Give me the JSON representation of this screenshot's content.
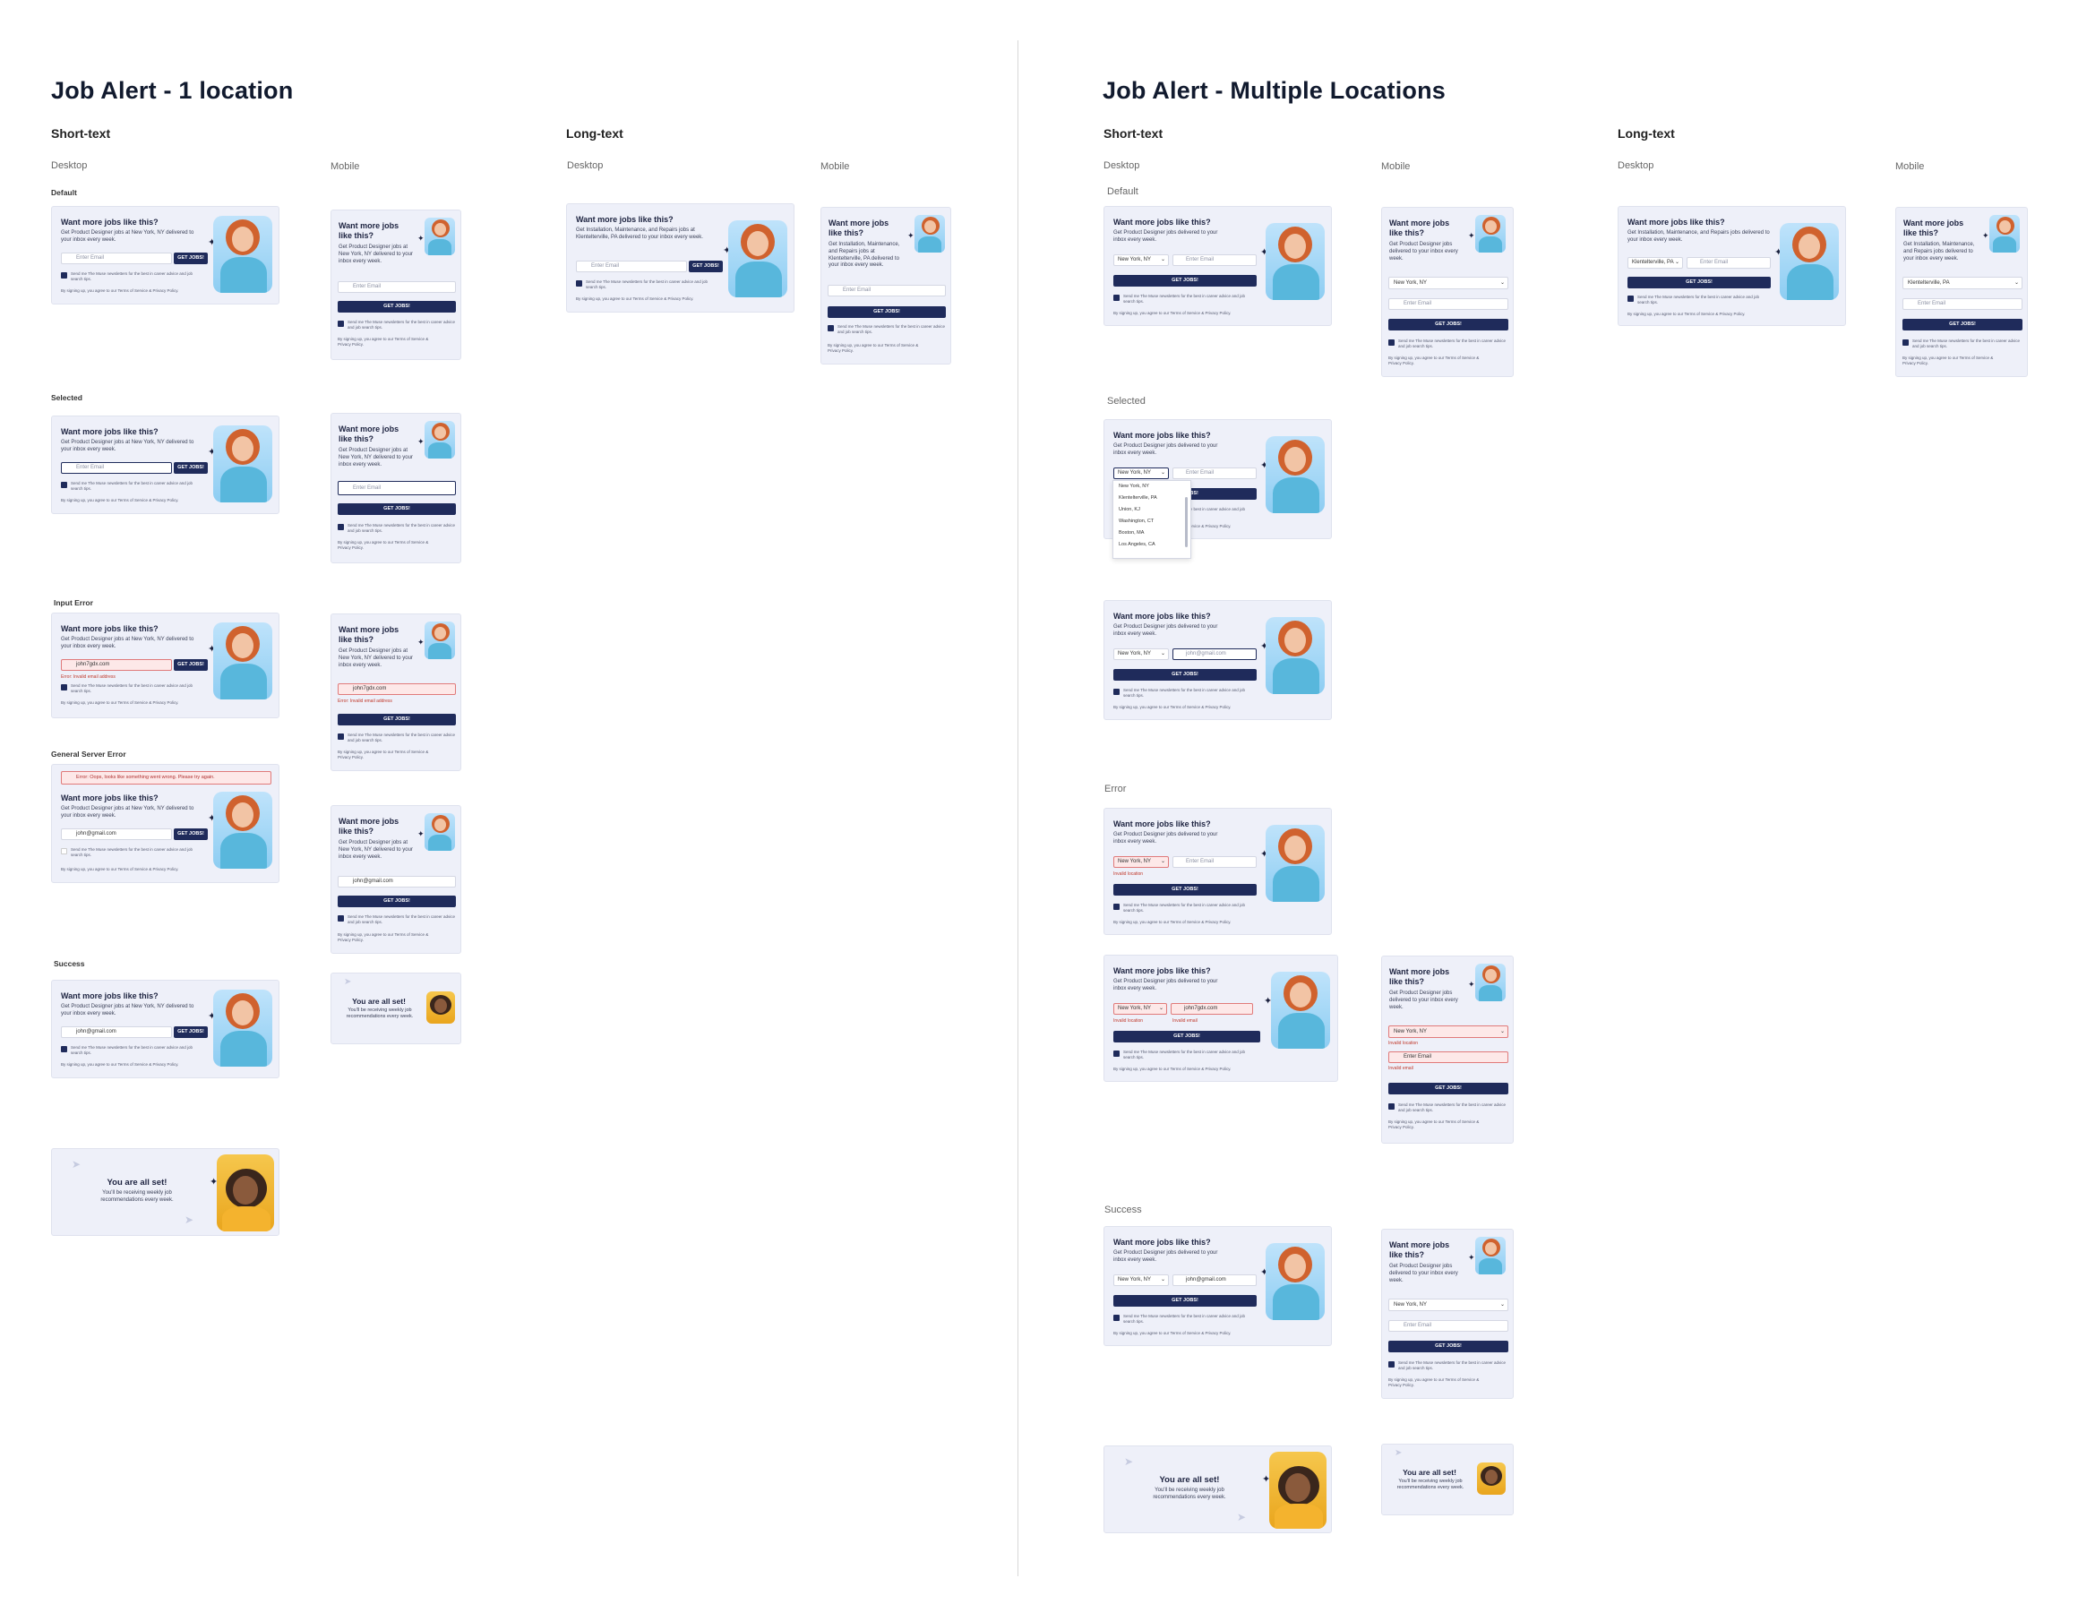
{
  "left": {
    "title": "Job Alert - 1 location",
    "short_text": "Short-text",
    "long_text": "Long-text",
    "desktop": "Desktop",
    "mobile": "Mobile",
    "desktop2": "Desktop",
    "mobile2": "Mobile",
    "states": {
      "default": "Default",
      "selected": "Selected",
      "input_error": "Input Error",
      "server_error": "General Server Error",
      "success": "Success"
    }
  },
  "right": {
    "title": "Job Alert - Multiple Locations",
    "short_text": "Short-text",
    "long_text": "Long-text",
    "desktop": "Desktop",
    "mobile": "Mobile",
    "desktop2": "Desktop",
    "mobile2": "Mobile",
    "states": {
      "default": "Default",
      "selected": "Selected",
      "error": "Error",
      "success": "Success"
    }
  },
  "card": {
    "title": "Want more jobs like this?",
    "desc_short": "Get Product Designer jobs at New York, NY delivered to your inbox every week.",
    "desc_multi": "Get Product Designer jobs delivered to your inbox every week.",
    "desc_long": "Get Installation, Maintenance, and Repairs jobs at Klentelterville, PA delivered to your inbox every week.",
    "desc_long_multi": "Get Installation, Maintenance, and Repairs jobs delivered to your inbox every week.",
    "email_placeholder": "Enter Email",
    "email_value_err": "john7gdx.com",
    "email_value_ok": "john@gmail.com",
    "location_value": "New York, NY",
    "location_long": "Klentelterville, PA",
    "button": "GET JOBS!",
    "checkbox_text": "Send me The Muse newsletters for the best in career advice and job search tips.",
    "fine_print": "By signing up, you agree to our Terms of Service & Privacy Policy.",
    "error_email": "Error: Invalid email address",
    "error_location": "Invalid location",
    "error_email_short": "Invalid email",
    "server_error": "Error: Oops, looks like something went wrong. Please try again.",
    "success_title": "You are all set!",
    "success_desc": "You'll be receiving weekly job recommendations every week.",
    "dropdown_options": [
      "New York, NY",
      "Klentelterville, PA",
      "Union, KJ",
      "Washington, CT",
      "Boston, MA",
      "Los Angeles, CA"
    ]
  },
  "colors": {
    "card_bg": "#eef0f9",
    "button": "#1f2b5b",
    "error": "#c0392b",
    "error_bg": "#fde8e8"
  }
}
